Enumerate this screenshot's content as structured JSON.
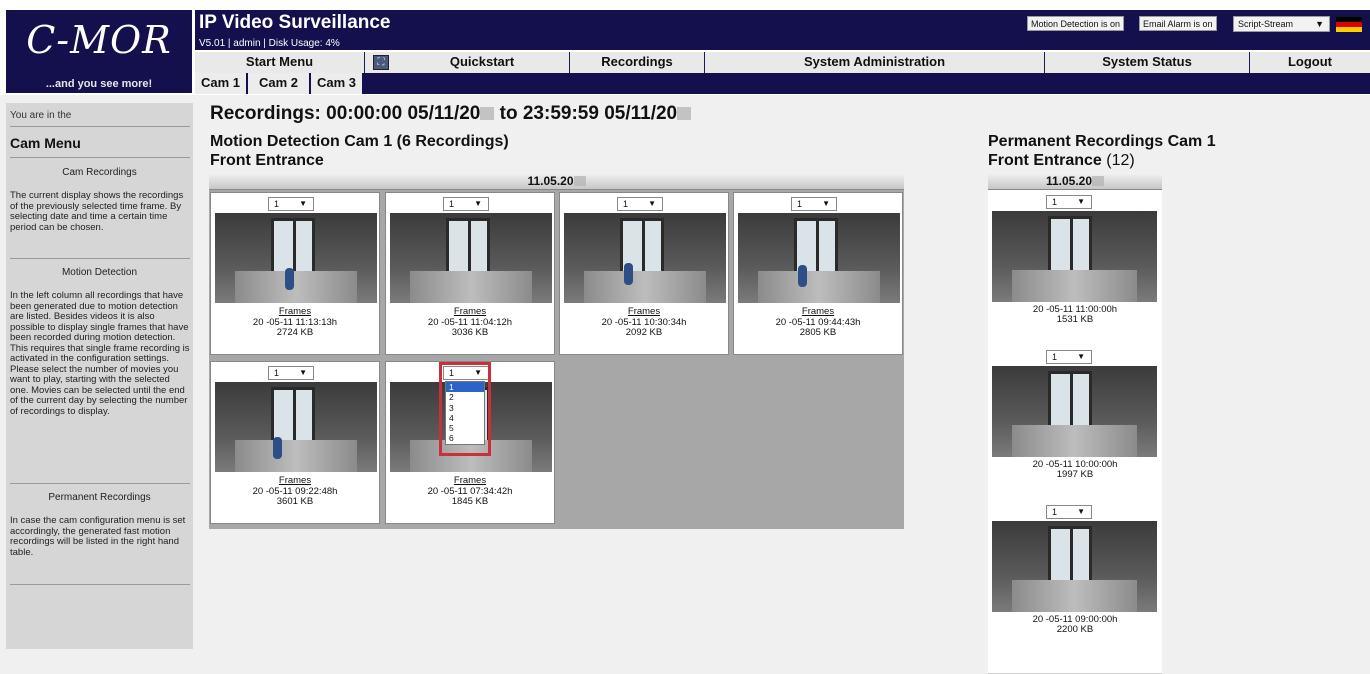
{
  "logo": {
    "text": "C-MOR",
    "slogan": "...and you see more!"
  },
  "header": {
    "title": "IP Video Surveillance",
    "subtitle": "V5.01 | admin | Disk Usage: 4%",
    "motion_badge": "Motion Detection is on",
    "email_badge": "Email Alarm is on",
    "stream_select": "Script-Stream",
    "flag_colors": [
      "#000000",
      "#dd0000",
      "#ffce00"
    ]
  },
  "nav": {
    "start_menu": "Start Menu",
    "quickstart": "Quickstart",
    "recordings": "Recordings",
    "system_admin": "System Administration",
    "system_status": "System Status",
    "logout": "Logout"
  },
  "cam_tabs": [
    "Cam 1",
    "Cam 2",
    "Cam 3"
  ],
  "sidebar": {
    "you_are_in": "You are in the",
    "menu_title": "Cam Menu",
    "sections": [
      {
        "heading": "Cam Recordings",
        "text": "The current display shows the recordings of the previously selected time frame. By selecting date and time a certain time period can be chosen."
      },
      {
        "heading": "Motion Detection",
        "text": "In the left column all recordings that have been generated due to motion detection are listed. Besides videos it is also possible to display single frames that have been recorded during motion detection. This requires that single frame recording is activated in the configuration settings. Please select the number of movies you want to play, starting with the selected one. Movies can be selected until the end of the current day by selecting the number of recordings to display."
      },
      {
        "heading": "Permanent Recordings",
        "text": "In case the cam configuration menu is set accordingly, the generated fast motion recordings will be listed in the right hand table."
      }
    ]
  },
  "main": {
    "title_prefix": "Recordings: 00:00:00 05/11/20",
    "title_mid": " to 23:59:59 05/11/20",
    "motion_title": "Motion Detection Cam 1 (6 Recordings)",
    "motion_subtitle": "Front Entrance",
    "date_head": "11.05.20",
    "frames_label": "Frames",
    "select_value": "1",
    "recordings": [
      {
        "time": "20  -05-11 11:13:13h",
        "size": "2724 KB"
      },
      {
        "time": "20  -05-11 11:04:12h",
        "size": "3036 KB"
      },
      {
        "time": "20  -05-11 10:30:34h",
        "size": "2092 KB"
      },
      {
        "time": "20  -05-11 09:44:43h",
        "size": "2805 KB"
      },
      {
        "time": "20  -05-11 09:22:48h",
        "size": "3601 KB"
      },
      {
        "time": "20  -05-11 07:34:42h",
        "size": "1845 KB"
      }
    ],
    "dropdown_options": [
      "1",
      "2",
      "3",
      "4",
      "5",
      "6"
    ]
  },
  "permanent": {
    "title": "Permanent Recordings Cam 1",
    "subtitle": "Front Entrance",
    "count": "(12)",
    "date_head": "11.05.20",
    "recordings": [
      {
        "time": "20   -05-11 11:00:00h",
        "size": "1531 KB"
      },
      {
        "time": "20   -05-11 10:00:00h",
        "size": "1997 KB"
      },
      {
        "time": "20   -05-11 09:00:00h",
        "size": "2200 KB"
      }
    ]
  }
}
